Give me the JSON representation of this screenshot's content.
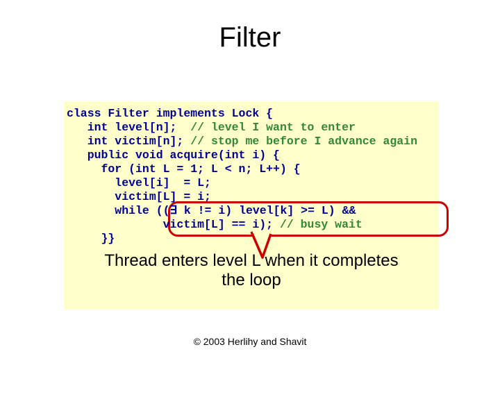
{
  "title": "Filter",
  "code": {
    "l1": "class Filter implements Lock {",
    "l2a": "   int level[n];  ",
    "l2c": "// level I want to enter",
    "l3a": "   int victim[n]; ",
    "l3c": "// stop me before I advance again",
    "l4": "   public void acquire(int i) {",
    "l5": "     for (int L = 1; L < n; L++) {",
    "l6": "       level[i]  = L;",
    "l7": "       victim[L] = i;",
    "l8": "       while ((∃ k != i) level[k] >= L) &&",
    "l9a": "              victim[L] == i); ",
    "l9c": "// busy wait",
    "l10": "     }}"
  },
  "explain_line1": "Thread enters level L when it completes",
  "explain_line2": "the loop",
  "copyright": "© 2003 Herlihy and Shavit"
}
